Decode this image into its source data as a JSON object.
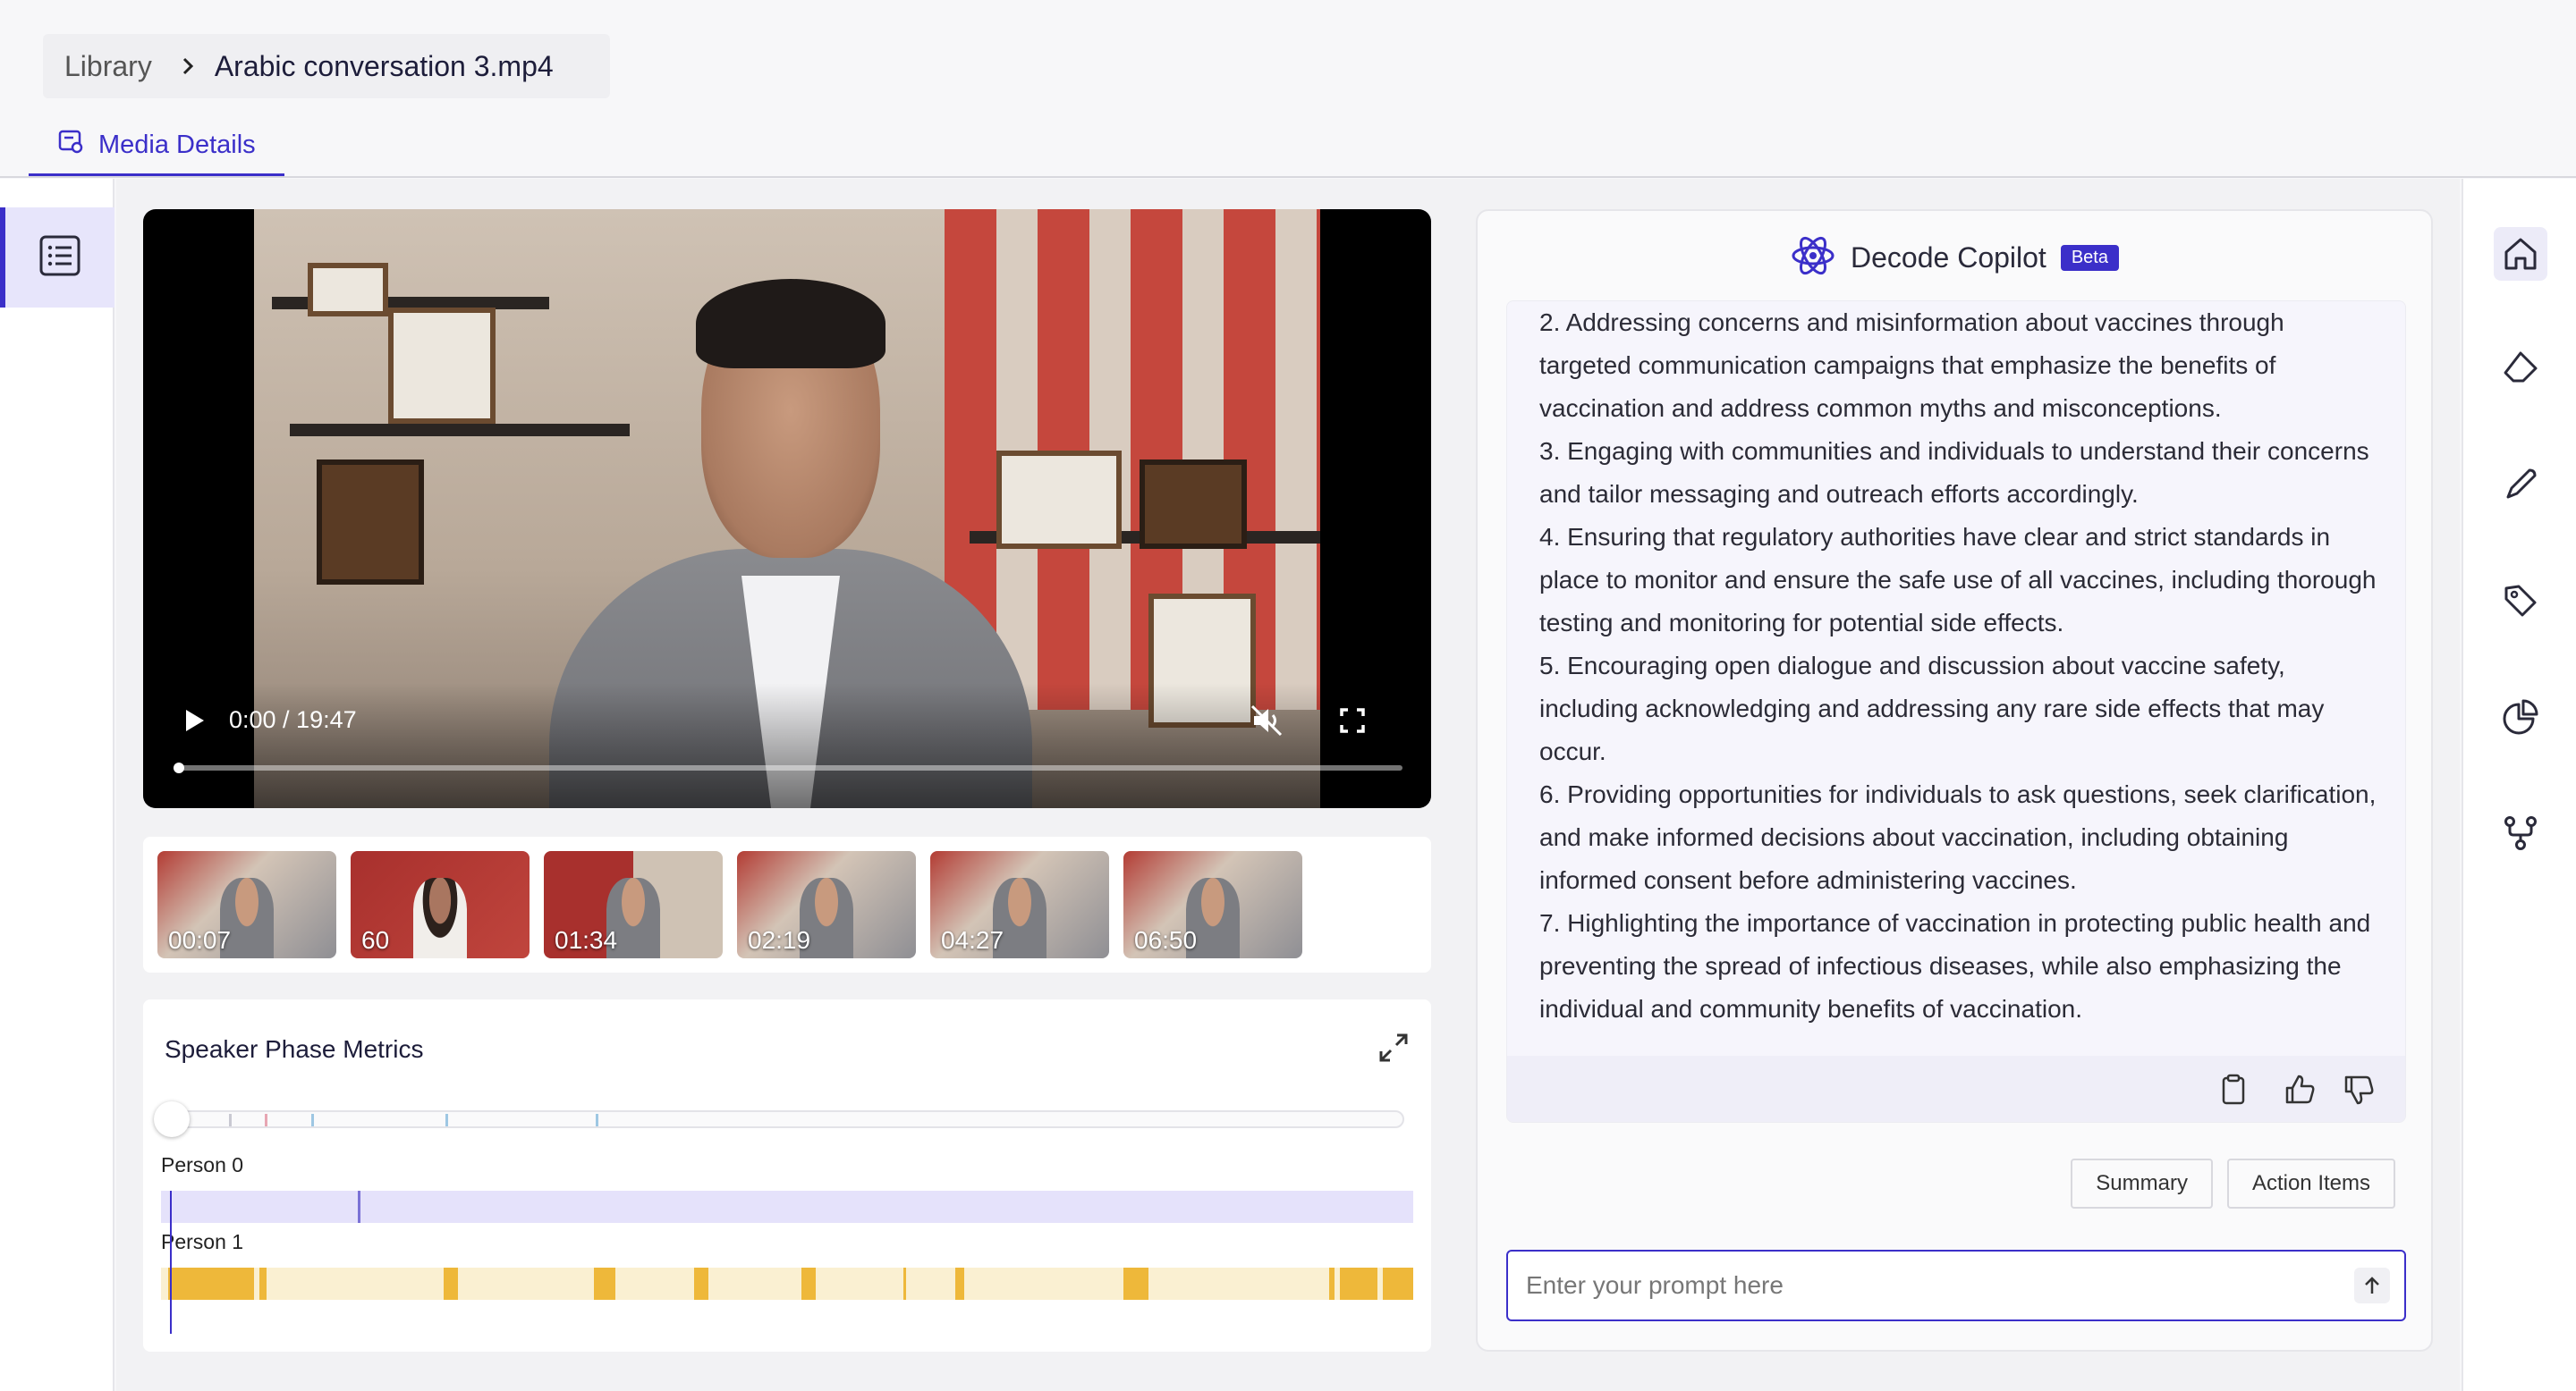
{
  "breadcrumb": {
    "root": "Library",
    "current": "Arabic conversation 3.mp4"
  },
  "tabs": [
    {
      "label": "Media Details"
    }
  ],
  "video": {
    "time_display": "0:00 / 19:47",
    "progress_fraction": 0.0
  },
  "thumbnails": [
    {
      "label": "00:07",
      "style": "gray"
    },
    {
      "label": "60",
      "style": "red"
    },
    {
      "label": "01:34",
      "style": "split"
    },
    {
      "label": "02:19",
      "style": "gray"
    },
    {
      "label": "04:27",
      "style": "gray"
    },
    {
      "label": "06:50",
      "style": "gray"
    }
  ],
  "metrics": {
    "title": "Speaker Phase Metrics",
    "persons": [
      {
        "label": "Person 0"
      },
      {
        "label": "Person 1"
      }
    ]
  },
  "copilot": {
    "title": "Decode Copilot",
    "badge": "Beta",
    "answer_lines": [
      "2. Addressing concerns and misinformation about vaccines through targeted communication campaigns that emphasize the benefits of vaccination and address common myths and misconceptions.",
      "3. Engaging with communities and individuals to understand their concerns and tailor messaging and outreach efforts accordingly.",
      "4. Ensuring that regulatory authorities have clear and strict standards in place to monitor and ensure the safe use of all vaccines, including thorough testing and monitoring for potential side effects.",
      "5. Encouraging open dialogue and discussion about vaccine safety, including acknowledging and addressing any rare side effects that may occur.",
      "6. Providing opportunities for individuals to ask questions, seek clarification, and make informed decisions about vaccination, including obtaining informed consent before administering vaccines.",
      "7. Highlighting the importance of vaccination in protecting public health and preventing the spread of infectious diseases, while also emphasizing the individual and community benefits of vaccination."
    ],
    "chips": [
      "Summary",
      "Action Items"
    ],
    "prompt_placeholder": "Enter your prompt here"
  },
  "right_rail": [
    {
      "icon": "home-icon",
      "active": true
    },
    {
      "icon": "eraser-icon",
      "active": false
    },
    {
      "icon": "pen-icon",
      "active": false
    },
    {
      "icon": "tag-icon",
      "active": false
    },
    {
      "icon": "pie-chart-icon",
      "active": false
    },
    {
      "icon": "workflow-icon",
      "active": false
    }
  ],
  "colors": {
    "accent": "#3b2fc9",
    "speaker0": "#e5e2fb",
    "speaker1_bg": "#faf0d2",
    "speaker1_seg": "#eeb83a"
  }
}
